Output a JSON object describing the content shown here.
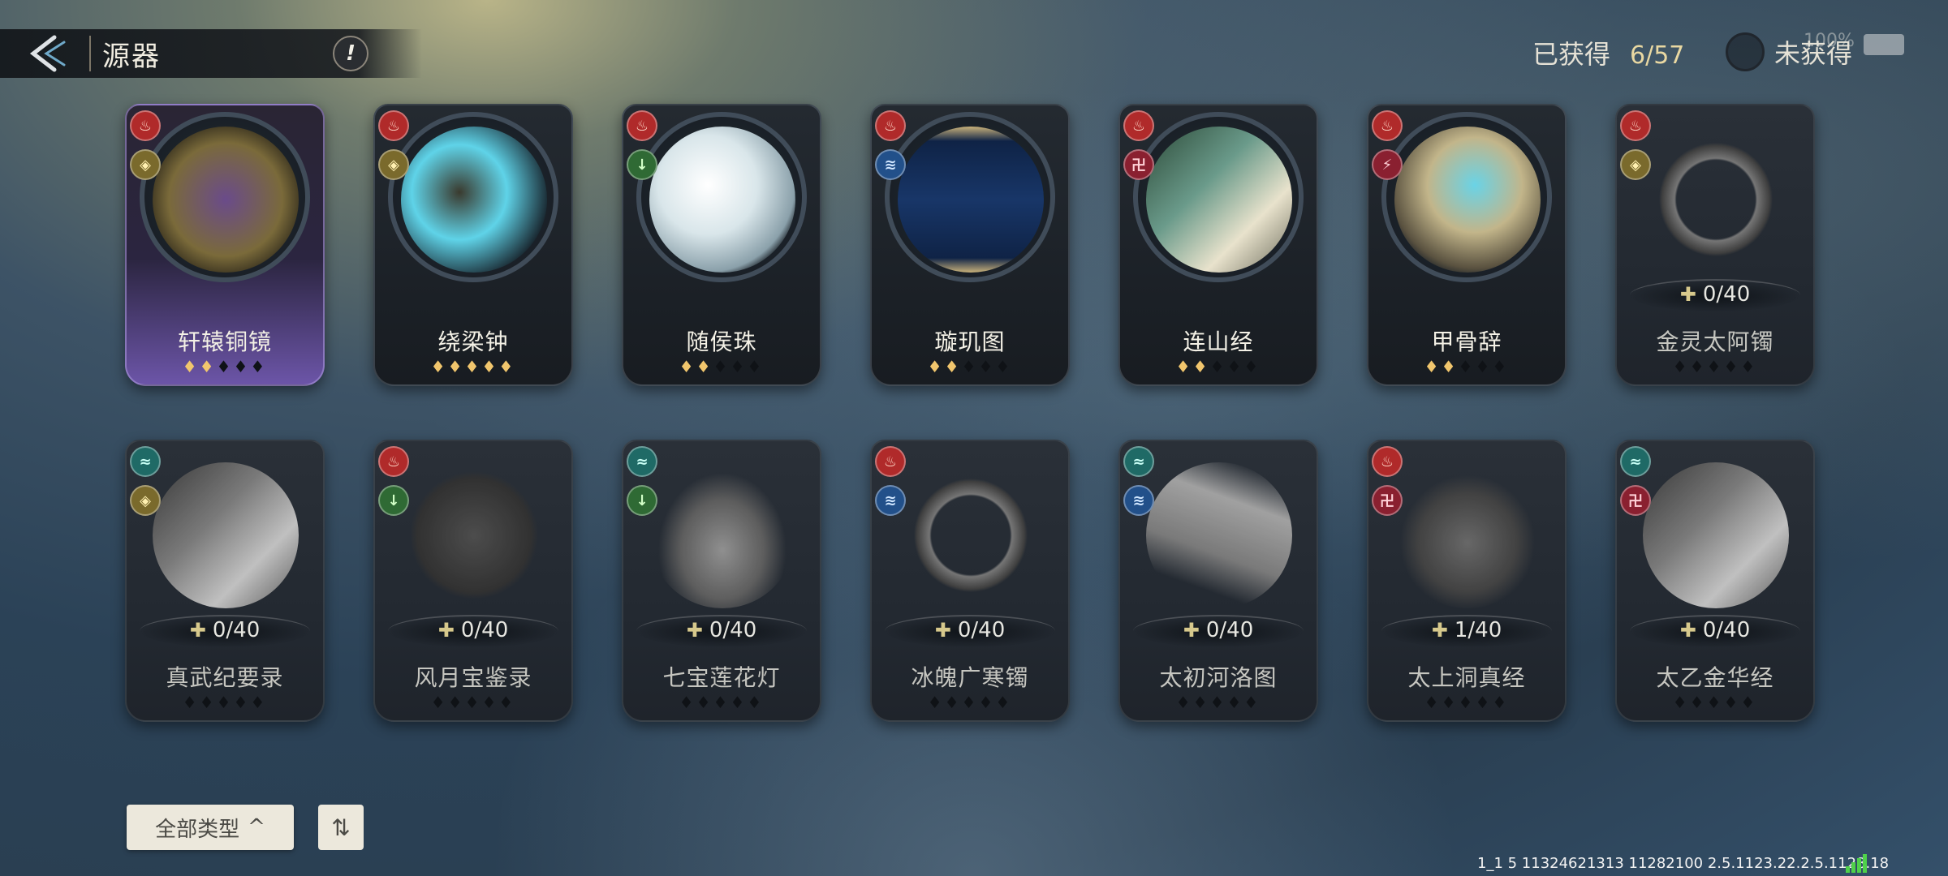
{
  "header": {
    "title": "源器",
    "info_glyph": "!"
  },
  "summary": {
    "obtained_label": "已获得",
    "obtained_count": "6/57",
    "toggle_label": "未获得",
    "battery_text": "100%"
  },
  "elements": {
    "fire": "#b02a2a",
    "wave": "#1f6a66",
    "gold": "#7a6a2c",
    "green": "#2f6a34",
    "blue": "#22508a",
    "red": "#8a2030"
  },
  "items": [
    {
      "name": "轩辕铜镜",
      "owned": true,
      "stars": 2,
      "progress": "",
      "badges": [
        "fire-icon",
        "gold-diamond-icon"
      ],
      "art": "bronze-mirror"
    },
    {
      "name": "绕梁钟",
      "owned": true,
      "stars": 5,
      "progress": "",
      "badges": [
        "fire-icon",
        "gold-diamond-icon"
      ],
      "art": "bell"
    },
    {
      "name": "随侯珠",
      "owned": true,
      "stars": 2,
      "progress": "",
      "badges": [
        "fire-icon",
        "green-arrow-icon"
      ],
      "art": "pearl"
    },
    {
      "name": "璇玑图",
      "owned": true,
      "stars": 2,
      "progress": "",
      "badges": [
        "fire-icon",
        "blue-wave-icon"
      ],
      "art": "star-scroll"
    },
    {
      "name": "连山经",
      "owned": true,
      "stars": 2,
      "progress": "",
      "badges": [
        "fire-icon",
        "red-swirl-icon"
      ],
      "art": "book"
    },
    {
      "name": "甲骨辞",
      "owned": true,
      "stars": 2,
      "progress": "",
      "badges": [
        "fire-icon",
        "red-script-icon"
      ],
      "art": "oracle-bone"
    },
    {
      "name": "金灵太阿镯",
      "owned": false,
      "stars": 0,
      "progress": "0/40",
      "badges": [
        "fire-icon",
        "gold-diamond-icon"
      ],
      "art": "bracelet"
    },
    {
      "name": "真武纪要录",
      "owned": false,
      "stars": 0,
      "progress": "0/40",
      "badges": [
        "wave-icon",
        "gold-diamond-icon"
      ],
      "art": "book"
    },
    {
      "name": "风月宝鉴录",
      "owned": false,
      "stars": 0,
      "progress": "0/40",
      "badges": [
        "fire-icon",
        "green-arrow-icon"
      ],
      "art": "mirror"
    },
    {
      "name": "七宝莲花灯",
      "owned": false,
      "stars": 0,
      "progress": "0/40",
      "badges": [
        "wave-icon",
        "green-arrow-icon"
      ],
      "art": "lotus"
    },
    {
      "name": "冰魄广寒镯",
      "owned": false,
      "stars": 0,
      "progress": "0/40",
      "badges": [
        "fire-icon",
        "blue-wave-icon"
      ],
      "art": "bracelet"
    },
    {
      "name": "太初河洛图",
      "owned": false,
      "stars": 0,
      "progress": "0/40",
      "badges": [
        "wave-icon",
        "blue-wave-icon"
      ],
      "art": "scroll"
    },
    {
      "name": "太上洞真经",
      "owned": false,
      "stars": 0,
      "progress": "1/40",
      "badges": [
        "fire-icon",
        "red-swirl-icon"
      ],
      "art": "books"
    },
    {
      "name": "太乙金华经",
      "owned": false,
      "stars": 0,
      "progress": "0/40",
      "badges": [
        "wave-icon",
        "red-swirl-icon"
      ],
      "art": "book"
    }
  ],
  "controls": {
    "filter_label": "全部类型",
    "filter_chevron": "^",
    "sort_glyph": "⇅"
  },
  "footer": {
    "version": "1_1 5 11324621313  11282100  2.5.1123.22.2.5.1128.18"
  }
}
